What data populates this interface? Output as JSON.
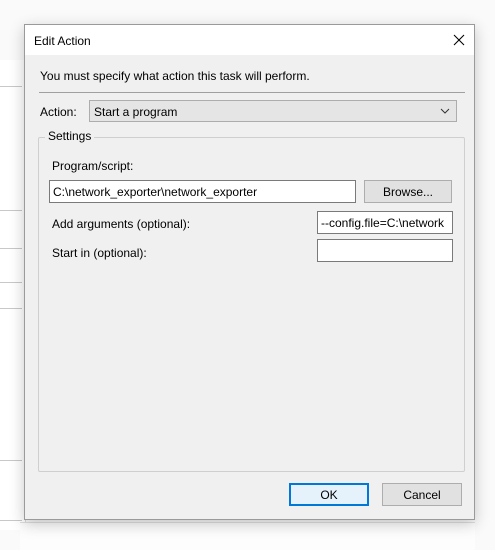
{
  "dialog": {
    "title": "Edit Action",
    "close_icon": "close-icon",
    "instruction": "You must specify what action this task will perform.",
    "action_label": "Action:",
    "action_value": "Start a program",
    "settings_label": "Settings",
    "program_label": "Program/script:",
    "program_value": "C:\\network_exporter\\network_exporter",
    "browse_label": "Browse...",
    "arguments_label": "Add arguments (optional):",
    "arguments_value": "--config.file=C:\\network",
    "start_in_label": "Start in (optional):",
    "start_in_value": "",
    "ok_label": "OK",
    "cancel_label": "Cancel"
  },
  "colors": {
    "focus_border": "#0078d7",
    "dialog_bg": "#f0f0f0"
  }
}
